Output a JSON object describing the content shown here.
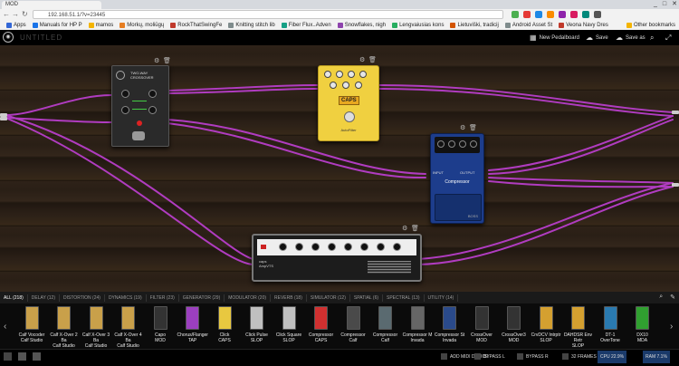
{
  "browser": {
    "tab_title": "MOD",
    "url": "192.168.51.1/?v=23445",
    "window_controls": [
      "_",
      "□",
      "✕"
    ],
    "bookmarks": [
      {
        "label": "Apps",
        "color": "#3367d6"
      },
      {
        "label": "Manuals for HP P",
        "color": "#1a73e8"
      },
      {
        "label": "mamos",
        "color": "#f4b400"
      },
      {
        "label": "Morkų, moliūgų",
        "color": "#e67e22"
      },
      {
        "label": "RockThatSwingFe",
        "color": "#c0392b"
      },
      {
        "label": "Knitting stitch lib",
        "color": "#7f8c8d"
      },
      {
        "label": "Fiber Flux..Adven",
        "color": "#16a085"
      },
      {
        "label": "Snowflakes, nigh",
        "color": "#8e44ad"
      },
      {
        "label": "Lengvaiusias kons",
        "color": "#27ae60"
      },
      {
        "label": "Lietuviški, tradicij",
        "color": "#d35400"
      },
      {
        "label": "Android Asset St",
        "color": "#7f8c8d"
      },
      {
        "label": "Veona Navy Dres",
        "color": "#c0392b"
      },
      {
        "label": "Other bookmarks",
        "color": "#f4b400"
      }
    ]
  },
  "header": {
    "title": "UNTITLED",
    "new_pedalboard": "New Pedalboard",
    "save": "Save",
    "save_as": "Save as"
  },
  "pedals": {
    "crossover": {
      "title": "TWO-WAY CROSSOVER"
    },
    "autofilter": {
      "brand": "CAPS",
      "name": "AutoFilter"
    },
    "compressor": {
      "input": "INPUT",
      "output": "OUTPUT",
      "name": "Compressor",
      "brand": "BOSS"
    },
    "amp": {
      "brand": "caps",
      "name": "AmpVTS"
    }
  },
  "categories": [
    {
      "label": "ALL (218)",
      "active": true
    },
    {
      "label": "DELAY (12)"
    },
    {
      "label": "DISTORTION (24)"
    },
    {
      "label": "DYNAMICS (19)"
    },
    {
      "label": "FILTER (23)"
    },
    {
      "label": "GENERATOR (29)"
    },
    {
      "label": "MODULATOR (20)"
    },
    {
      "label": "REVERB (18)"
    },
    {
      "label": "SIMULATOR (12)"
    },
    {
      "label": "SPATIAL (6)"
    },
    {
      "label": "SPECTRAL (13)"
    },
    {
      "label": "UTILITY (14)"
    }
  ],
  "plugins": [
    {
      "name": "Calf Vocoder",
      "brand": "Calf Studio",
      "color": "#c9a04a"
    },
    {
      "name": "Calf X-Over 2 Ba",
      "brand": "Calf Studio",
      "color": "#c9a04a"
    },
    {
      "name": "Calf X-Over 3 Ba",
      "brand": "Calf Studio",
      "color": "#c9a04a"
    },
    {
      "name": "Calf X-Over 4 Ba",
      "brand": "Calf Studio",
      "color": "#c9a04a"
    },
    {
      "name": "Capo",
      "brand": "MOD",
      "color": "#333333"
    },
    {
      "name": "Chorus/Flanger",
      "brand": "TAP",
      "color": "#9b3fbf"
    },
    {
      "name": "Click",
      "brand": "CAPS",
      "color": "#e8c840"
    },
    {
      "name": "Click Pulse",
      "brand": "SLOP",
      "color": "#c0c0c0"
    },
    {
      "name": "Click Square",
      "brand": "SLOP",
      "color": "#c0c0c0"
    },
    {
      "name": "Compressor",
      "brand": "CAPS",
      "color": "#d03030"
    },
    {
      "name": "Compressor",
      "brand": "Calf",
      "color": "#4a4a4a"
    },
    {
      "name": "Compressor",
      "brand": "Calf",
      "color": "#5a6a70"
    },
    {
      "name": "Compressor M",
      "brand": "Invada",
      "color": "#666666"
    },
    {
      "name": "Compressor St",
      "brand": "Invada",
      "color": "#2a4a8a"
    },
    {
      "name": "CrossOver",
      "brand": "MOD",
      "color": "#333333"
    },
    {
      "name": "CrossOver3",
      "brand": "MOD",
      "color": "#333333"
    },
    {
      "name": "CrvDCV Intrptr",
      "brand": "SLOP",
      "color": "#d4a030"
    },
    {
      "name": "DAHDSR Env Retr",
      "brand": "SLOP",
      "color": "#d4a030"
    },
    {
      "name": "DT-1",
      "brand": "OverTone",
      "color": "#2a7ab0"
    },
    {
      "name": "DX10",
      "brand": "MDA",
      "color": "#30a030"
    }
  ],
  "status": {
    "add_midi": "ADD MIDI DEVICE",
    "bypass_l": "BYPASS L",
    "bypass_r": "BYPASS R",
    "frames": "32 FRAMES",
    "cpu": "CPU 22.9%",
    "ram": "RAM 7.1%"
  }
}
